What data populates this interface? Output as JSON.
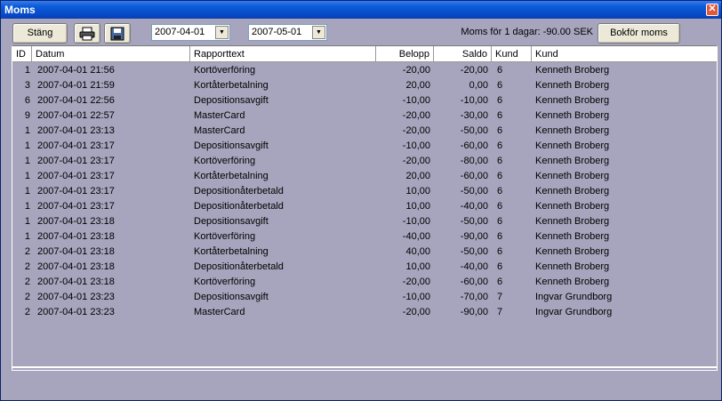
{
  "window": {
    "title": "Moms",
    "close_glyph": "✕"
  },
  "toolbar": {
    "close_label": "Stäng",
    "print_icon": "printer-icon",
    "save_icon": "floppy-disk-icon",
    "date_from": "2007-04-01",
    "date_to": "2007-05-01",
    "status_text": "Moms för 1 dagar: -90.00 SEK",
    "book_label": "Bokför moms"
  },
  "table": {
    "headers": [
      "ID",
      "Datum",
      "Rapporttext",
      "Belopp",
      "Saldo",
      "Kund",
      "Kund"
    ],
    "rows": [
      [
        "1",
        "2007-04-01 21:56",
        "Kortöverföring",
        "-20,00",
        "-20,00",
        "6",
        "Kenneth Broberg"
      ],
      [
        "3",
        "2007-04-01 21:59",
        "Kortåterbetalning",
        "20,00",
        "0,00",
        "6",
        "Kenneth Broberg"
      ],
      [
        "6",
        "2007-04-01 22:56",
        "Depositionsavgift",
        "-10,00",
        "-10,00",
        "6",
        "Kenneth Broberg"
      ],
      [
        "9",
        "2007-04-01 22:57",
        "MasterCard",
        "-20,00",
        "-30,00",
        "6",
        "Kenneth Broberg"
      ],
      [
        "1",
        "2007-04-01 23:13",
        "MasterCard",
        "-20,00",
        "-50,00",
        "6",
        "Kenneth Broberg"
      ],
      [
        "1",
        "2007-04-01 23:17",
        "Depositionsavgift",
        "-10,00",
        "-60,00",
        "6",
        "Kenneth Broberg"
      ],
      [
        "1",
        "2007-04-01 23:17",
        "Kortöverföring",
        "-20,00",
        "-80,00",
        "6",
        "Kenneth Broberg"
      ],
      [
        "1",
        "2007-04-01 23:17",
        "Kortåterbetalning",
        "20,00",
        "-60,00",
        "6",
        "Kenneth Broberg"
      ],
      [
        "1",
        "2007-04-01 23:17",
        "Depositionåterbetald",
        "10,00",
        "-50,00",
        "6",
        "Kenneth Broberg"
      ],
      [
        "1",
        "2007-04-01 23:17",
        "Depositionåterbetald",
        "10,00",
        "-40,00",
        "6",
        "Kenneth Broberg"
      ],
      [
        "1",
        "2007-04-01 23:18",
        "Depositionsavgift",
        "-10,00",
        "-50,00",
        "6",
        "Kenneth Broberg"
      ],
      [
        "1",
        "2007-04-01 23:18",
        "Kortöverföring",
        "-40,00",
        "-90,00",
        "6",
        "Kenneth Broberg"
      ],
      [
        "2",
        "2007-04-01 23:18",
        "Kortåterbetalning",
        "40,00",
        "-50,00",
        "6",
        "Kenneth Broberg"
      ],
      [
        "2",
        "2007-04-01 23:18",
        "Depositionåterbetald",
        "10,00",
        "-40,00",
        "6",
        "Kenneth Broberg"
      ],
      [
        "2",
        "2007-04-01 23:18",
        "Kortöverföring",
        "-20,00",
        "-60,00",
        "6",
        "Kenneth Broberg"
      ],
      [
        "2",
        "2007-04-01 23:23",
        "Depositionsavgift",
        "-10,00",
        "-70,00",
        "7",
        "Ingvar Grundborg"
      ],
      [
        "2",
        "2007-04-01 23:23",
        "MasterCard",
        "-20,00",
        "-90,00",
        "7",
        "Ingvar Grundborg"
      ]
    ]
  }
}
